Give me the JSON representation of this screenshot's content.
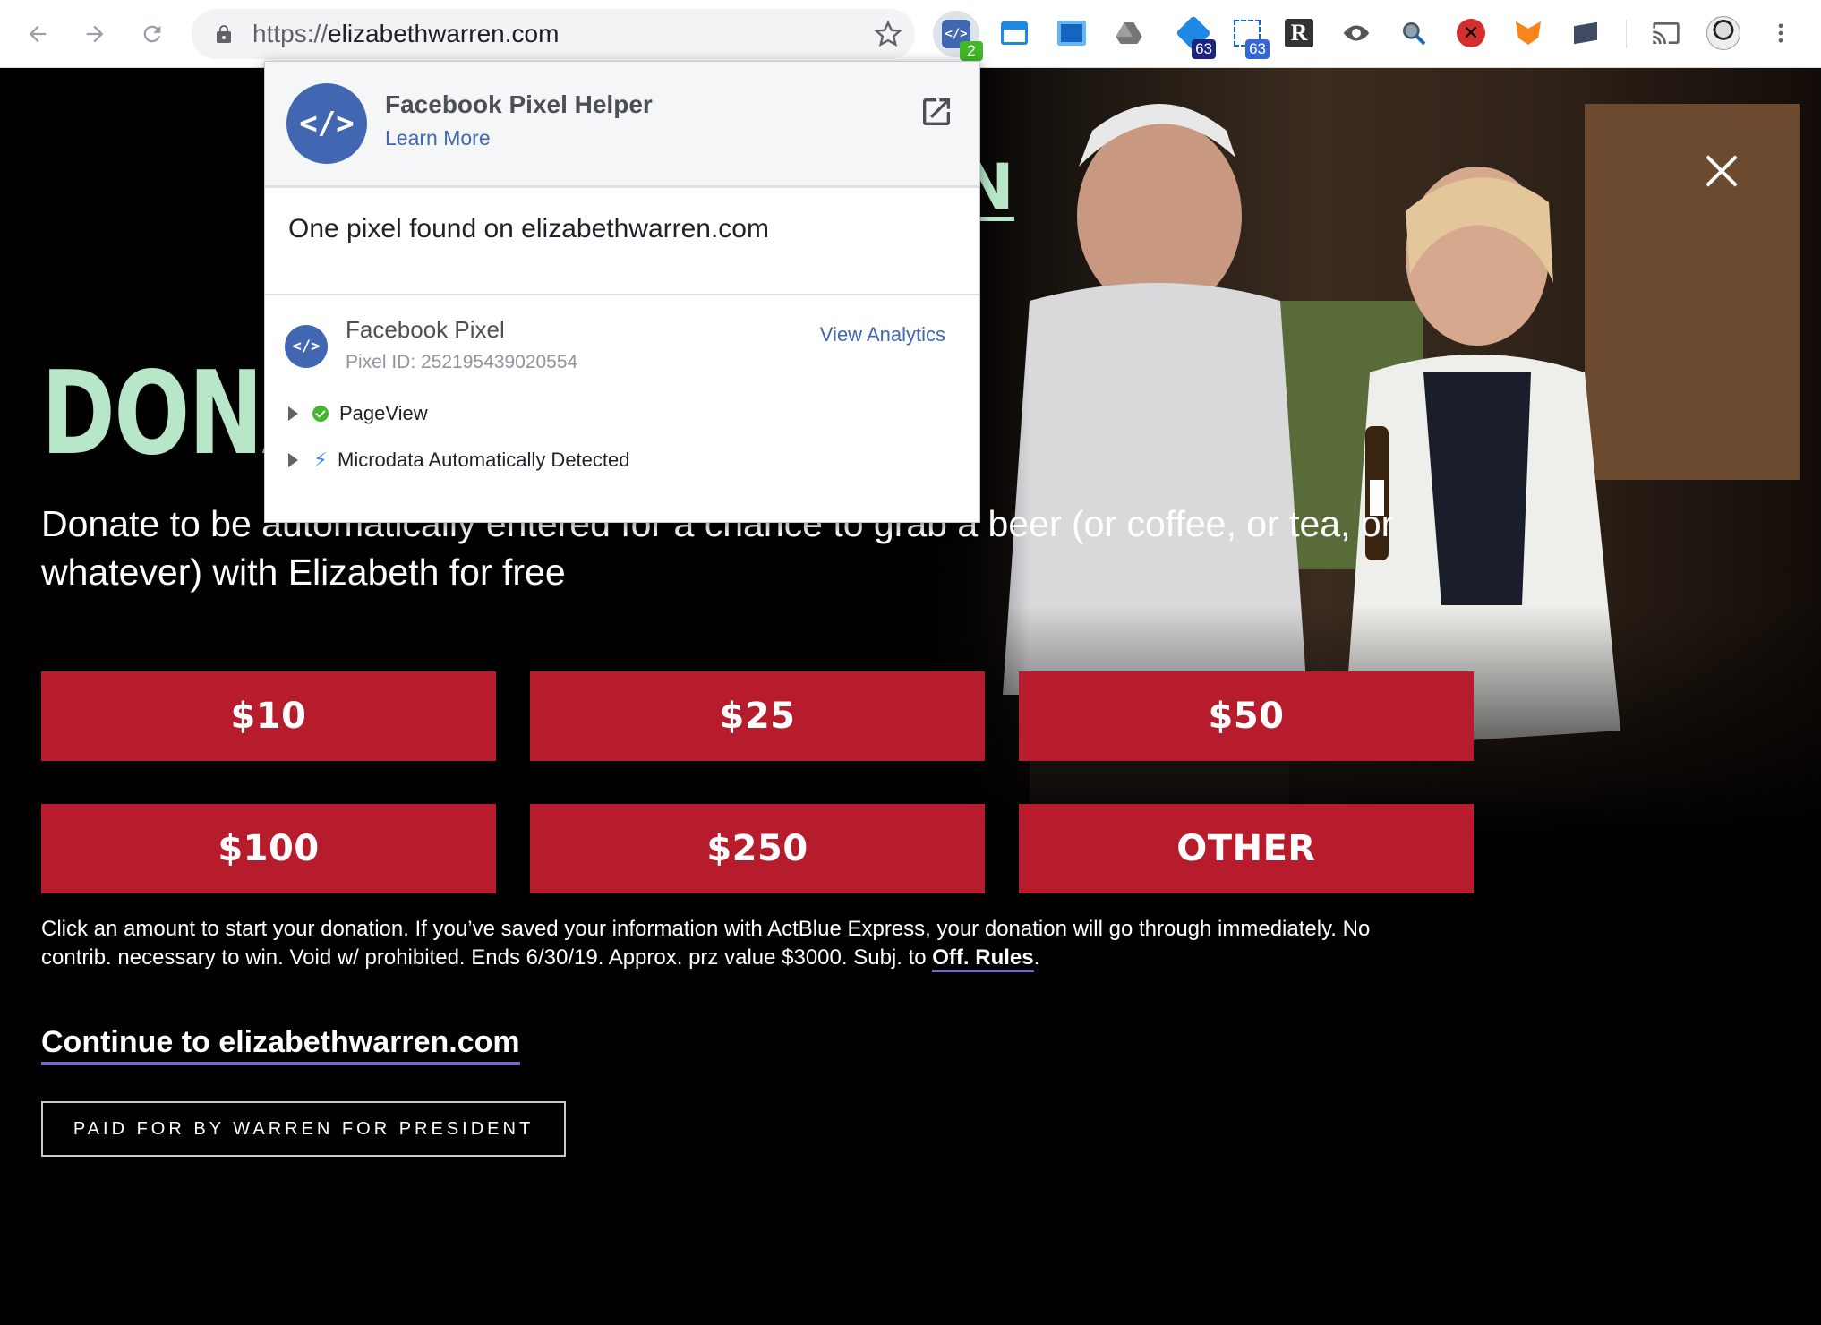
{
  "browser": {
    "url_scheme": "https://",
    "url_host": "elizabethwarren.com",
    "extensions": [
      {
        "name": "facebook-pixel-helper-icon",
        "badge": "2",
        "badge_color": "#42b72a"
      },
      {
        "name": "window-icon"
      },
      {
        "name": "screenshot-icon"
      },
      {
        "name": "google-drive-icon"
      },
      {
        "name": "extension-icon",
        "badge": "63",
        "badge_color": "#1a237e"
      },
      {
        "name": "extension-icon",
        "badge": "63",
        "badge_color": "#3367d6"
      },
      {
        "name": "r-extension-icon"
      },
      {
        "name": "eye-icon"
      },
      {
        "name": "search-icon"
      },
      {
        "name": "blocker-icon"
      },
      {
        "name": "metamask-fox-icon"
      },
      {
        "name": "extension-icon"
      },
      {
        "name": "cast-icon"
      },
      {
        "name": "profile-avatar-icon"
      },
      {
        "name": "menu-dots-icon"
      }
    ]
  },
  "popup": {
    "title": "Facebook Pixel Helper",
    "learn_more": "Learn More",
    "found_text": "One pixel found on elizabethwarren.com",
    "pixel": {
      "name": "Facebook Pixel",
      "id_label": "Pixel ID: 252195439020554",
      "analytics_link": "View Analytics",
      "events": [
        {
          "label": "PageView",
          "status": "success"
        },
        {
          "label": "Microdata Automatically Detected",
          "status": "info"
        }
      ]
    }
  },
  "page": {
    "headline": "DONA",
    "headline_partial_right": "N",
    "subhead": "Donate to be automatically entered for a chance to grab a beer (or coffee, or tea, or whatever) with Elizabeth for free",
    "amounts": [
      "$10",
      "$25",
      "$50",
      "$100",
      "$250",
      "OTHER"
    ],
    "fine_print": "Click an amount to start your donation. If you’ve saved your information with ActBlue Express, your donation will go through immediately. No contrib. necessary to win. Void w/ prohibited. Ends 6/30/19. Approx. prz value $3000. Subj. to ",
    "rules_link": "Off. Rules",
    "fine_print_end": ".",
    "continue_link": "Continue to elizabethwarren.com",
    "paid_for": "PAID FOR BY WARREN FOR PRESIDENT"
  },
  "colors": {
    "accent_green": "#b8e6c9",
    "donate_red": "#b71c2c",
    "link_underline": "#6f6bc4",
    "facebook_blue": "#4267b2"
  }
}
